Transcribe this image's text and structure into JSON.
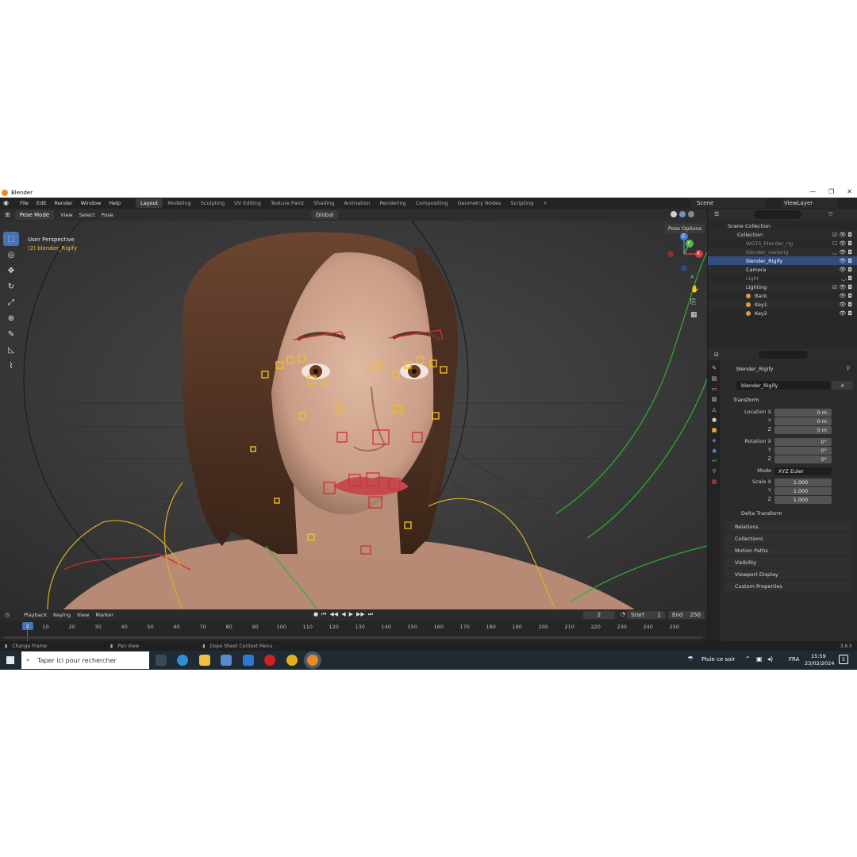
{
  "window": {
    "title": "Blender",
    "controls": [
      "—",
      "❐",
      "✕"
    ]
  },
  "menu": [
    "File",
    "Edit",
    "Render",
    "Window",
    "Help"
  ],
  "workspaces": [
    "Layout",
    "Modeling",
    "Sculpting",
    "UV Editing",
    "Texture Paint",
    "Shading",
    "Animation",
    "Rendering",
    "Compositing",
    "Geometry Nodes",
    "Scripting"
  ],
  "active_workspace": "Layout",
  "scene": "Scene",
  "view_layer": "ViewLayer",
  "viewport_header": {
    "mode": "Pose Mode",
    "menus": [
      "View",
      "Select",
      "Pose"
    ],
    "orientation": "Global",
    "pose_options": "Pose Options"
  },
  "viewport": {
    "label": "User Perspective",
    "object_label": "(2) blender_Rigify",
    "gizmo_axes": {
      "z": "Z",
      "y": "Y",
      "x": "X"
    }
  },
  "outliner": {
    "rows": [
      {
        "name": "Scene Collection",
        "indent": 0
      },
      {
        "name": "Collection",
        "indent": 1
      },
      {
        "name": "WGTS_blender_rig",
        "indent": 2,
        "dim": true
      },
      {
        "name": "blender_metarig",
        "indent": 2,
        "dim": true
      },
      {
        "name": "blender_Rigify",
        "indent": 2,
        "selected": true
      },
      {
        "name": "Camera",
        "indent": 2
      },
      {
        "name": "Light",
        "indent": 2,
        "dim": true
      },
      {
        "name": "Lighting",
        "indent": 2
      },
      {
        "name": "Back",
        "indent": 3
      },
      {
        "name": "Key1",
        "indent": 3
      },
      {
        "name": "Key2",
        "indent": 3
      }
    ]
  },
  "properties": {
    "object_name": "blender_Rigify",
    "data_name": "blender_Rigify",
    "data_users": "4",
    "transform_title": "Transform",
    "location": {
      "label": "Location X",
      "x": "0 m",
      "y": "0 m",
      "z": "0 m"
    },
    "rotation": {
      "label": "Rotation X",
      "x": "0°",
      "y": "0°",
      "z": "0°"
    },
    "axis_y": "Y",
    "axis_z": "Z",
    "mode_label": "Mode",
    "mode_value": "XYZ Euler",
    "scale": {
      "label": "Scale X",
      "x": "1.000",
      "y": "1.000",
      "z": "1.000"
    },
    "delta": "Delta Transform",
    "panels": [
      "Relations",
      "Collections",
      "Motion Paths",
      "Visibility",
      "Viewport Display",
      "Custom Properties"
    ]
  },
  "timeline": {
    "menus": [
      "Playback",
      "Keying",
      "View",
      "Marker"
    ],
    "current_frame": "2",
    "start_label": "Start",
    "start": "1",
    "end_label": "End",
    "end": "250",
    "ticks": [
      "10",
      "20",
      "30",
      "40",
      "50",
      "60",
      "70",
      "80",
      "90",
      "100",
      "110",
      "120",
      "130",
      "140",
      "150",
      "160",
      "170",
      "180",
      "190",
      "200",
      "210",
      "220",
      "230",
      "240",
      "250"
    ]
  },
  "statusbar": {
    "left": "Change Frame",
    "mid": "Pan View",
    "right": "Dope Sheet Context Menu",
    "version": "3.6.5"
  },
  "taskbar": {
    "search_placeholder": "Taper ici pour rechercher",
    "weather": "Pluie ce soir",
    "language": "FRA",
    "time": "15:59",
    "date": "23/02/2024",
    "notifications": "5"
  },
  "colors": {
    "accent": "#4772b3",
    "rig_yellow": "#f0c020",
    "rig_red": "#d03030",
    "rig_green": "#30b030"
  }
}
